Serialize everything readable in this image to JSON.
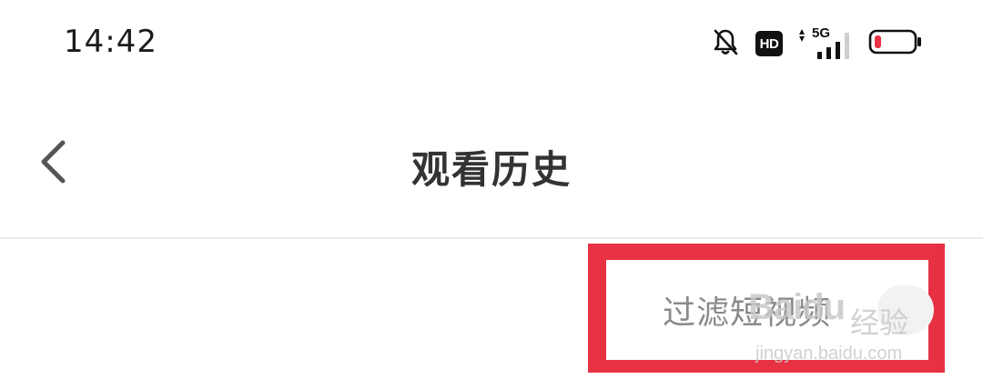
{
  "status_bar": {
    "time": "14:42",
    "icons": [
      "bell-off-icon",
      "hd-icon",
      "5g-signal-icon",
      "battery-low-icon"
    ],
    "hd_label": "HD",
    "network_label": "5G",
    "battery_color": "#e83244"
  },
  "header": {
    "back_icon": "chevron-left-icon",
    "title": "观看历史"
  },
  "filter": {
    "label": "过滤短视频",
    "highlight_color": "#e83244"
  },
  "watermark": {
    "brand": "Baidu",
    "product": "经验",
    "url": "jingyan.baidu.com"
  }
}
